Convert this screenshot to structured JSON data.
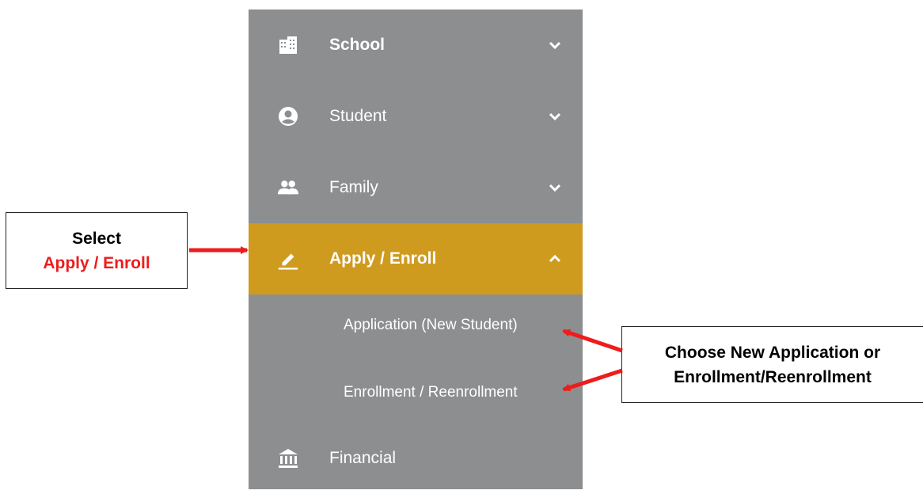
{
  "sidebar": {
    "items": [
      {
        "label": "School",
        "icon": "building-icon",
        "chevron": "chevron-down-icon"
      },
      {
        "label": "Student",
        "icon": "account-circle-icon",
        "chevron": "chevron-down-icon"
      },
      {
        "label": "Family",
        "icon": "people-icon",
        "chevron": "chevron-down-icon"
      },
      {
        "label": "Apply / Enroll",
        "icon": "pencil-icon",
        "chevron": "chevron-up-icon",
        "active": true,
        "subitems": [
          "Application (New Student)",
          "Enrollment / Reenrollment"
        ]
      },
      {
        "label": "Financial",
        "icon": "bank-icon"
      }
    ],
    "colors": {
      "background": "#8c8e90",
      "active": "#cf9b1f",
      "text": "#ffffff"
    }
  },
  "callouts": {
    "select": {
      "line1": "Select",
      "line2": "Apply / Enroll"
    },
    "choose": {
      "line1": "Choose New Application or",
      "line2": "Enrollment/Reenrollment"
    },
    "colors": {
      "arrow": "#ee1c1c",
      "highlight_text": "#ee1c1c"
    }
  }
}
